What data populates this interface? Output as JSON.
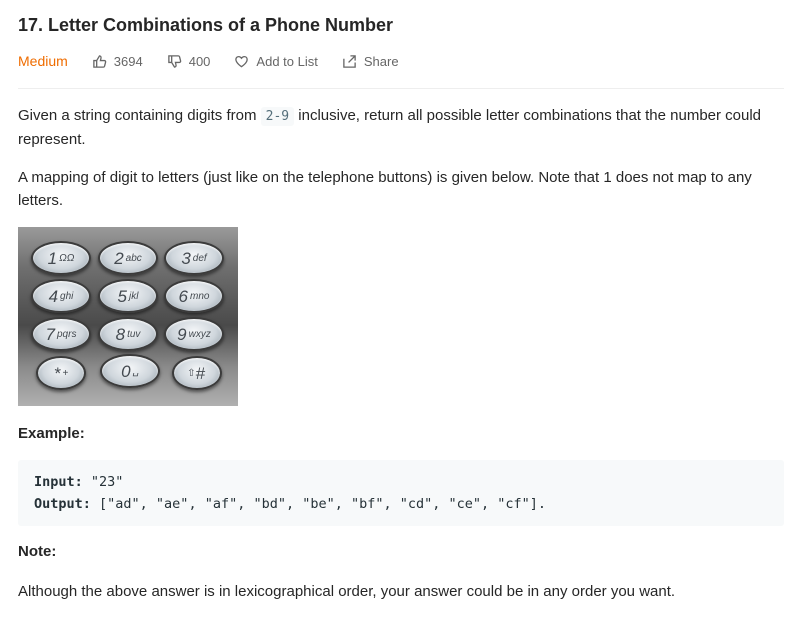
{
  "problem": {
    "title": "17. Letter Combinations of a Phone Number",
    "difficulty": "Medium",
    "likes": "3694",
    "dislikes": "400",
    "add_to_list": "Add to List",
    "share": "Share"
  },
  "description": {
    "p1_before": "Given a string containing digits from ",
    "p1_code": "2-9",
    "p1_after": " inclusive, return all possible letter combinations that the number could represent.",
    "p2": "A mapping of digit to letters (just like on the telephone buttons) is given below. Note that 1 does not map to any letters."
  },
  "keypad": {
    "keys": [
      {
        "digit": "1",
        "letters": "ΩΩ"
      },
      {
        "digit": "2",
        "letters": "abc"
      },
      {
        "digit": "3",
        "letters": "def"
      },
      {
        "digit": "4",
        "letters": "ghi"
      },
      {
        "digit": "5",
        "letters": "jkl"
      },
      {
        "digit": "6",
        "letters": "mno"
      },
      {
        "digit": "7",
        "letters": "pqrs"
      },
      {
        "digit": "8",
        "letters": "tuv"
      },
      {
        "digit": "9",
        "letters": "wxyz"
      },
      {
        "digit": "*",
        "letters": "+"
      },
      {
        "digit": "0",
        "letters": "␣"
      },
      {
        "digit": "#",
        "letters": "⇧"
      }
    ]
  },
  "example": {
    "heading": "Example:",
    "input_label": "Input:",
    "input_value": " \"23\"",
    "output_label": "Output:",
    "output_value": " [\"ad\", \"ae\", \"af\", \"bd\", \"be\", \"bf\", \"cd\", \"ce\", \"cf\"]."
  },
  "note": {
    "heading": "Note:",
    "text": "Although the above answer is in lexicographical order, your answer could be in any order you want."
  },
  "colors": {
    "difficulty": "#ef6c00",
    "code_bg": "#f7f9fa"
  }
}
